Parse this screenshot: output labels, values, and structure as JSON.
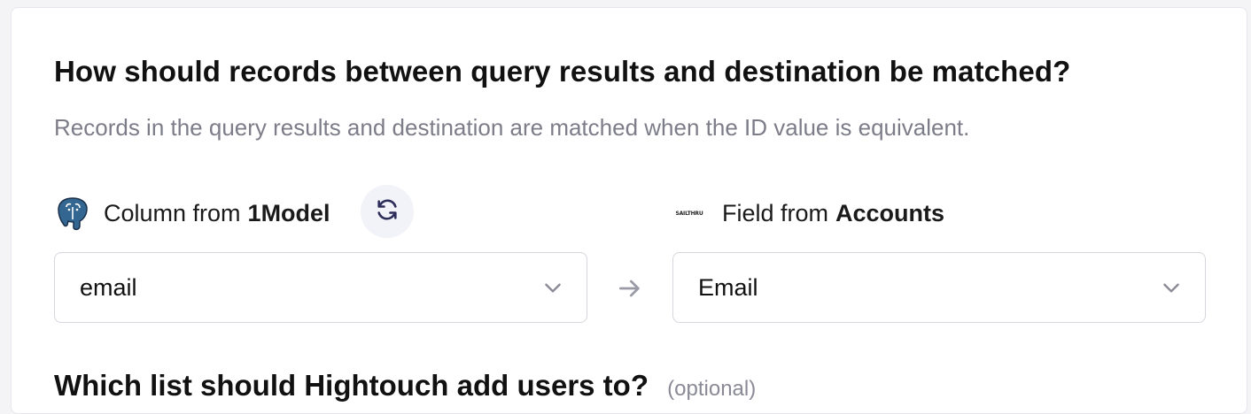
{
  "matching": {
    "title": "How should records between query results and destination be matched?",
    "subtitle": "Records in the query results and destination are matched when the ID value is equivalent."
  },
  "source": {
    "label_prefix": "Column from",
    "model_name": "1Model",
    "icon": "postgresql-icon",
    "selected_value": "email"
  },
  "destination": {
    "label_prefix": "Field from",
    "object_name": "Accounts",
    "icon": "sailthru-logo-icon",
    "logo_text": "SAILTHRU",
    "selected_value": "Email"
  },
  "list_section": {
    "title": "Which list should Hightouch add users to?",
    "optional_label": "(optional)"
  },
  "colors": {
    "accent": "#2d2d5a",
    "muted_text": "#7d7d89",
    "border": "#d6d6dd",
    "refresh_bg": "#f2f2f9"
  }
}
